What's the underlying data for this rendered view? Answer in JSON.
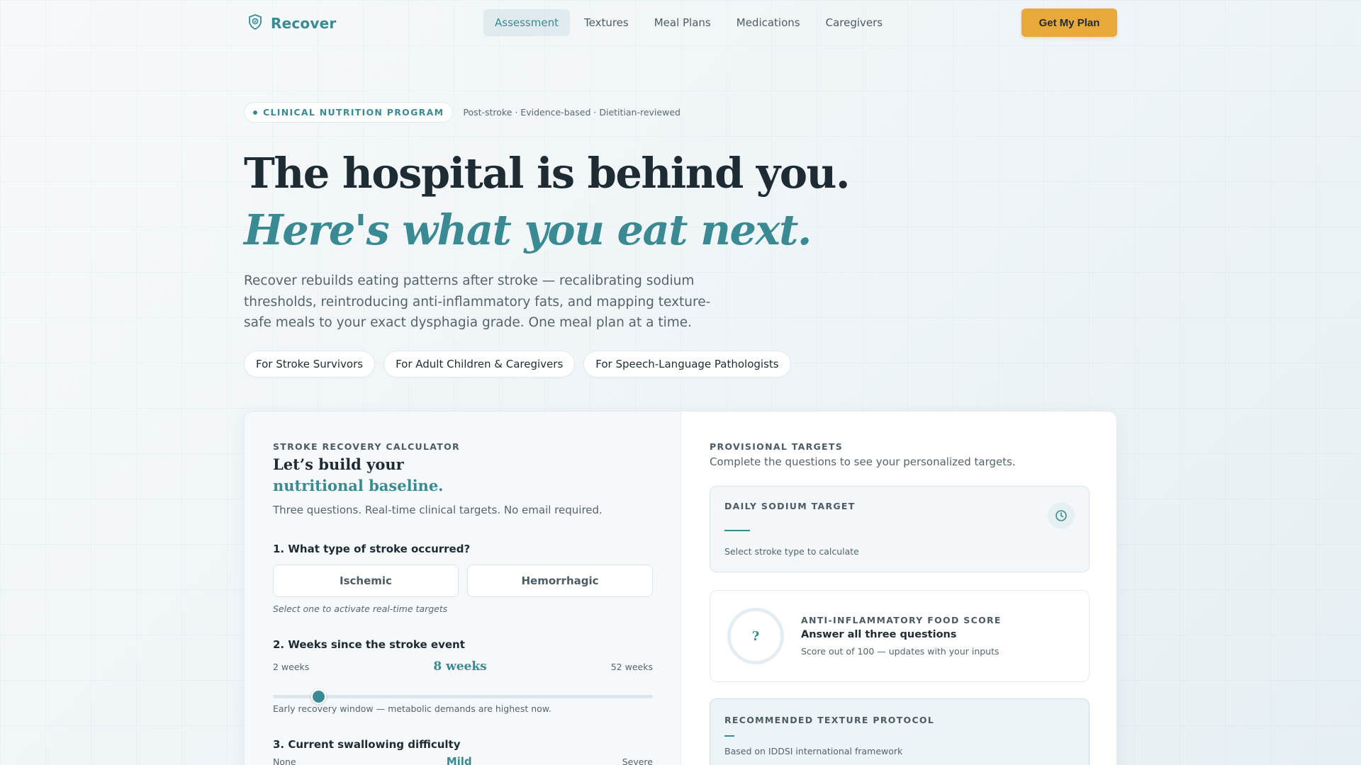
{
  "brand": {
    "name": "Recover",
    "icon": "shield-icon"
  },
  "nav": {
    "links": [
      "Assessment",
      "Textures",
      "Meal Plans",
      "Medications",
      "Caregivers"
    ],
    "active": "Assessment",
    "cta": "Get My Plan"
  },
  "hero": {
    "badge": "CLINICAL NUTRITION PROGRAM",
    "badge_meta": "Post-stroke · Evidence-based · Dietitian-reviewed",
    "title_line1": "The hospital is behind you.",
    "title_line2": "Here's what you eat next.",
    "lede": "Recover rebuilds eating patterns after stroke — recalibrating sodium thresholds, reintroducing anti-inflammatory fats, and mapping texture-safe meals to your exact dysphagia grade. One meal plan at a time.",
    "audiences": [
      "For Stroke Survivors",
      "For Adult Children & Caregivers",
      "For Speech-Language Pathologists"
    ]
  },
  "calculator": {
    "eyebrow": "STROKE RECOVERY CALCULATOR",
    "title_line1": "Let’s build your",
    "title_line2": "nutritional baseline.",
    "subtitle": "Three questions. Real-time clinical targets. No email required.",
    "q1": {
      "label": "1. What type of stroke occurred?",
      "options": [
        "Ischemic",
        "Hemorrhagic"
      ],
      "hint": "Select one to activate real-time targets"
    },
    "q2": {
      "label": "2. Weeks since the stroke event",
      "min_label": "2 weeks",
      "max_label": "52 weeks",
      "value_label": "8 weeks",
      "min": 2,
      "max": 52,
      "value": 8,
      "note": "Early recovery window — metabolic demands are highest now."
    },
    "q3": {
      "label": "3. Current swallowing difficulty",
      "min_label": "None",
      "max_label": "Severe",
      "value_label": "Mild"
    }
  },
  "targets": {
    "eyebrow": "PROVISIONAL TARGETS",
    "subtitle": "Complete the questions to see your personalized targets.",
    "sodium": {
      "eyebrow": "DAILY SODIUM TARGET",
      "note": "Select stroke type to calculate",
      "icon": "clock-icon"
    },
    "anti_inflammatory": {
      "score": "?",
      "eyebrow": "ANTI-INFLAMMATORY FOOD SCORE",
      "title": "Answer all three questions",
      "note": "Score out of 100 — updates with your inputs"
    },
    "texture": {
      "eyebrow": "RECOMMENDED TEXTURE PROTOCOL",
      "note": "Based on IDDSI international framework"
    }
  },
  "colors": {
    "accent": "#3a8a93",
    "cta": "#e9a93a",
    "ink": "#1e2b33"
  }
}
